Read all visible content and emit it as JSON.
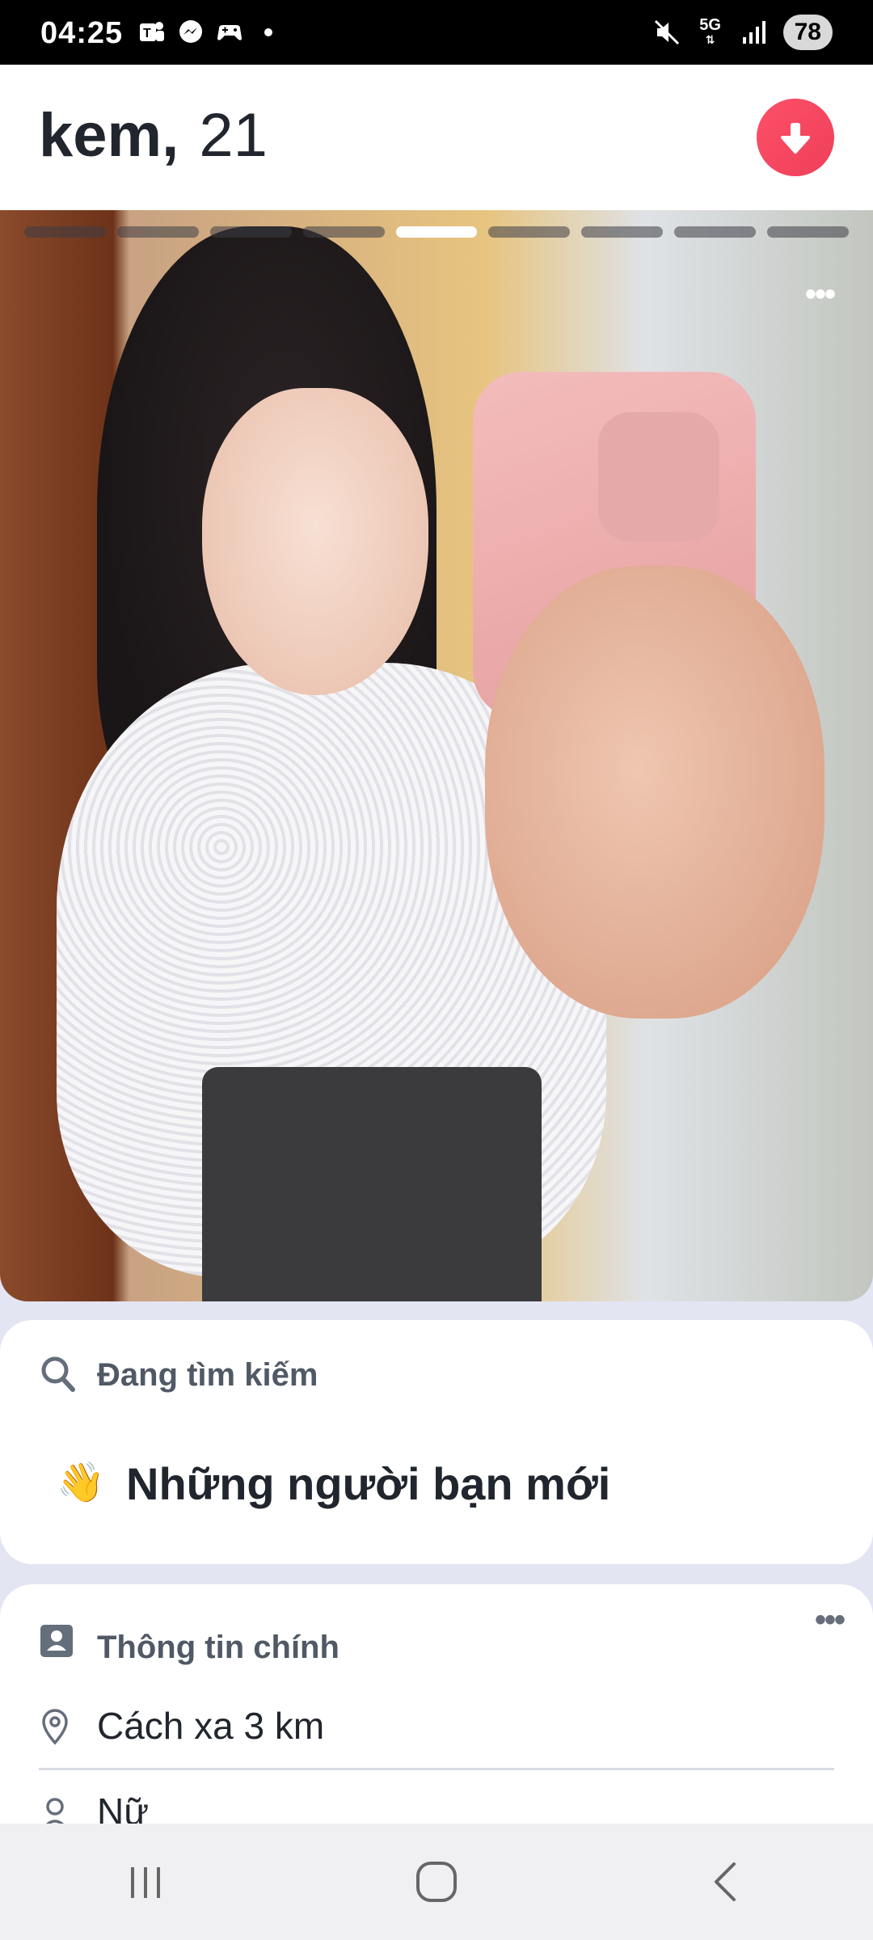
{
  "status_bar": {
    "time": "04:25",
    "icons": [
      "teams-icon",
      "messenger-icon",
      "game-controller-icon",
      "dot-icon"
    ],
    "right_icons": [
      "mute-icon",
      "5g-icon",
      "signal-icon"
    ],
    "network": "5G",
    "battery": "78"
  },
  "header": {
    "name": "kem,",
    "age": "21",
    "action_icon": "arrow-down-icon",
    "action_color": "#fd5068"
  },
  "photo": {
    "total_photos": 9,
    "active_index": 5,
    "menu_label": "•••"
  },
  "looking_for": {
    "label": "Đang tìm kiếm",
    "emoji": "👋",
    "value": "Những người bạn mới"
  },
  "basic_info": {
    "label": "Thông tin chính",
    "menu_label": "•••",
    "distance": "Cách xa 3 km",
    "gender": "Nữ"
  },
  "navbar": {
    "items": [
      "recent-apps-icon",
      "home-icon",
      "back-icon"
    ]
  }
}
